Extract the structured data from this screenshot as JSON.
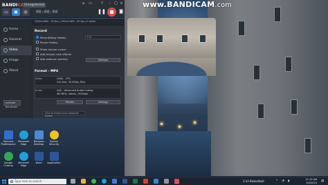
{
  "bandicam": {
    "logo_main": "BANDI",
    "logo_accent": "CAM",
    "unregistered": "Unregistered",
    "timer": "00:00:00",
    "file_info": "1920x1080 - 30 fps | 1920x1080 - 30 fps | 0 bytes",
    "status_button": "Activate Bandicam",
    "nav": [
      {
        "label": "Home"
      },
      {
        "label": "General"
      },
      {
        "label": "Video"
      },
      {
        "label": "Image"
      },
      {
        "label": "About"
      }
    ],
    "record": {
      "heading": "Record",
      "options": [
        {
          "label": "Record/Stop Hotkey",
          "checked": true
        },
        {
          "label": "Pause Hotkey",
          "checked": false
        },
        {
          "label": "Show mouse cursor",
          "checked": false
        },
        {
          "label": "Add mouse click effects",
          "checked": false
        },
        {
          "label": "Add webcam overlay",
          "checked": false
        }
      ],
      "hotkey_value": "F12",
      "settings_button": "Settings"
    },
    "format": {
      "heading": "Format - MP4",
      "video_key": "Video",
      "video_val": "H264 - CPU",
      "video_detail": "Full Size, 30.00fps, 80q",
      "audio_key": "Audio",
      "audio_val": "AAC - Advanced Audio Coding",
      "audio_detail": "48.0KHz, stereo, 192kbps",
      "presets_button": "Presets",
      "settings_button": "Settings"
    },
    "footer_hint": "Click to record your computer screen"
  },
  "watermark": {
    "main": "www.BANDICAM",
    "suffix": ".com"
  },
  "desktop_icons": [
    {
      "label": "Dialpack Professional",
      "color": "#2f6fd0"
    },
    {
      "label": "Microsoft Edge",
      "color": "#1f9fd8"
    },
    {
      "label": "Notepad Desktop",
      "color": "#4e8ad4"
    },
    {
      "label": "Norton Security",
      "color": "#f0c419"
    },
    {
      "label": "Google Chrome",
      "color": "#34a853"
    },
    {
      "label": "Microsoft Edge",
      "color": "#1f9fd8"
    },
    {
      "label": "Word",
      "color": "#2b579a"
    },
    {
      "label": "Application",
      "color": "#2b579a"
    },
    {
      "label": "Bandicam",
      "color": "#d9534f"
    },
    {
      "label": "Docs",
      "color": "#4f8ef0"
    }
  ],
  "taskbar": {
    "search_placeholder": "Type here to search",
    "weather": "3 k3 Basketball",
    "time": "11:10 AM",
    "date": "3/4/2024",
    "apps": [
      {
        "name": "task-view",
        "color": "#9aa6b5"
      },
      {
        "name": "file-explorer",
        "color": "#e8b23c"
      },
      {
        "name": "chrome",
        "color": "#3cba54"
      },
      {
        "name": "edge",
        "color": "#1f9fd8"
      },
      {
        "name": "store",
        "color": "#3d7be0"
      },
      {
        "name": "word",
        "color": "#2b579a"
      },
      {
        "name": "excel",
        "color": "#217346"
      },
      {
        "name": "powerpoint",
        "color": "#d24726"
      },
      {
        "name": "vscode",
        "color": "#2f8ad8"
      },
      {
        "name": "settings",
        "color": "#8996a7"
      },
      {
        "name": "bandicam",
        "color": "#e44949"
      }
    ]
  }
}
